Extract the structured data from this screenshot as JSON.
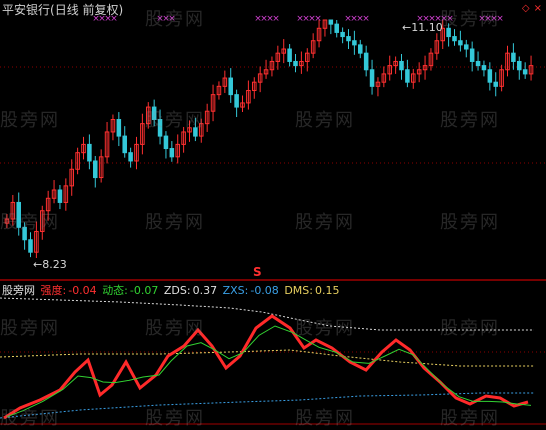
{
  "main": {
    "stock_name": "平安银行",
    "period_label": "(日线 前复权)",
    "high_label": "11.10",
    "low_label": "8.23",
    "signal_label": "S"
  },
  "indicator": {
    "name": "股旁网",
    "items": [
      {
        "label": "强度:",
        "value": "-0.04",
        "color": "#ff3030"
      },
      {
        "label": "动态:",
        "value": "-0.07",
        "color": "#32d232"
      },
      {
        "label": "ZDS:",
        "value": "0.37",
        "color": "#e0e0e0"
      },
      {
        "label": "ZXS:",
        "value": "-0.08",
        "color": "#3aa0e6"
      },
      {
        "label": "DMS:",
        "value": "0.15",
        "color": "#e8d060"
      }
    ]
  },
  "watermark": "股旁网",
  "colors": {
    "up": "#ff3030",
    "down": "#34c8d8",
    "grid": "#8b0000",
    "marker": "#d040d0"
  },
  "chart_data": {
    "type": "candlestick",
    "y_labels": [
      "11.10",
      "8.23"
    ],
    "closes": [
      8.7,
      8.9,
      8.6,
      8.45,
      8.3,
      8.55,
      8.8,
      8.95,
      9.05,
      8.9,
      9.1,
      9.3,
      9.5,
      9.6,
      9.4,
      9.2,
      9.45,
      9.75,
      9.9,
      9.7,
      9.5,
      9.4,
      9.6,
      9.85,
      10.05,
      9.9,
      9.7,
      9.55,
      9.45,
      9.6,
      9.75,
      9.8,
      9.7,
      9.85,
      10.0,
      10.2,
      10.3,
      10.4,
      10.2,
      10.05,
      10.1,
      10.25,
      10.35,
      10.45,
      10.5,
      10.6,
      10.7,
      10.75,
      10.6,
      10.55,
      10.6,
      10.7,
      10.85,
      11.0,
      11.1,
      11.05,
      10.95,
      10.9,
      10.85,
      10.8,
      10.7,
      10.5,
      10.3,
      10.35,
      10.45,
      10.55,
      10.6,
      10.5,
      10.35,
      10.45,
      10.5,
      10.55,
      10.7,
      10.85,
      11.0,
      10.9,
      10.85,
      10.8,
      10.75,
      10.6,
      10.55,
      10.5,
      10.35,
      10.3,
      10.5,
      10.7,
      10.6,
      10.5,
      10.45,
      10.55
    ],
    "indicator_series": [
      {
        "name": "强度",
        "value": -0.04
      },
      {
        "name": "动态",
        "value": -0.07
      },
      {
        "name": "ZDS",
        "value": 0.37
      },
      {
        "name": "ZXS",
        "value": -0.08
      },
      {
        "name": "DMS",
        "value": 0.15
      }
    ]
  }
}
